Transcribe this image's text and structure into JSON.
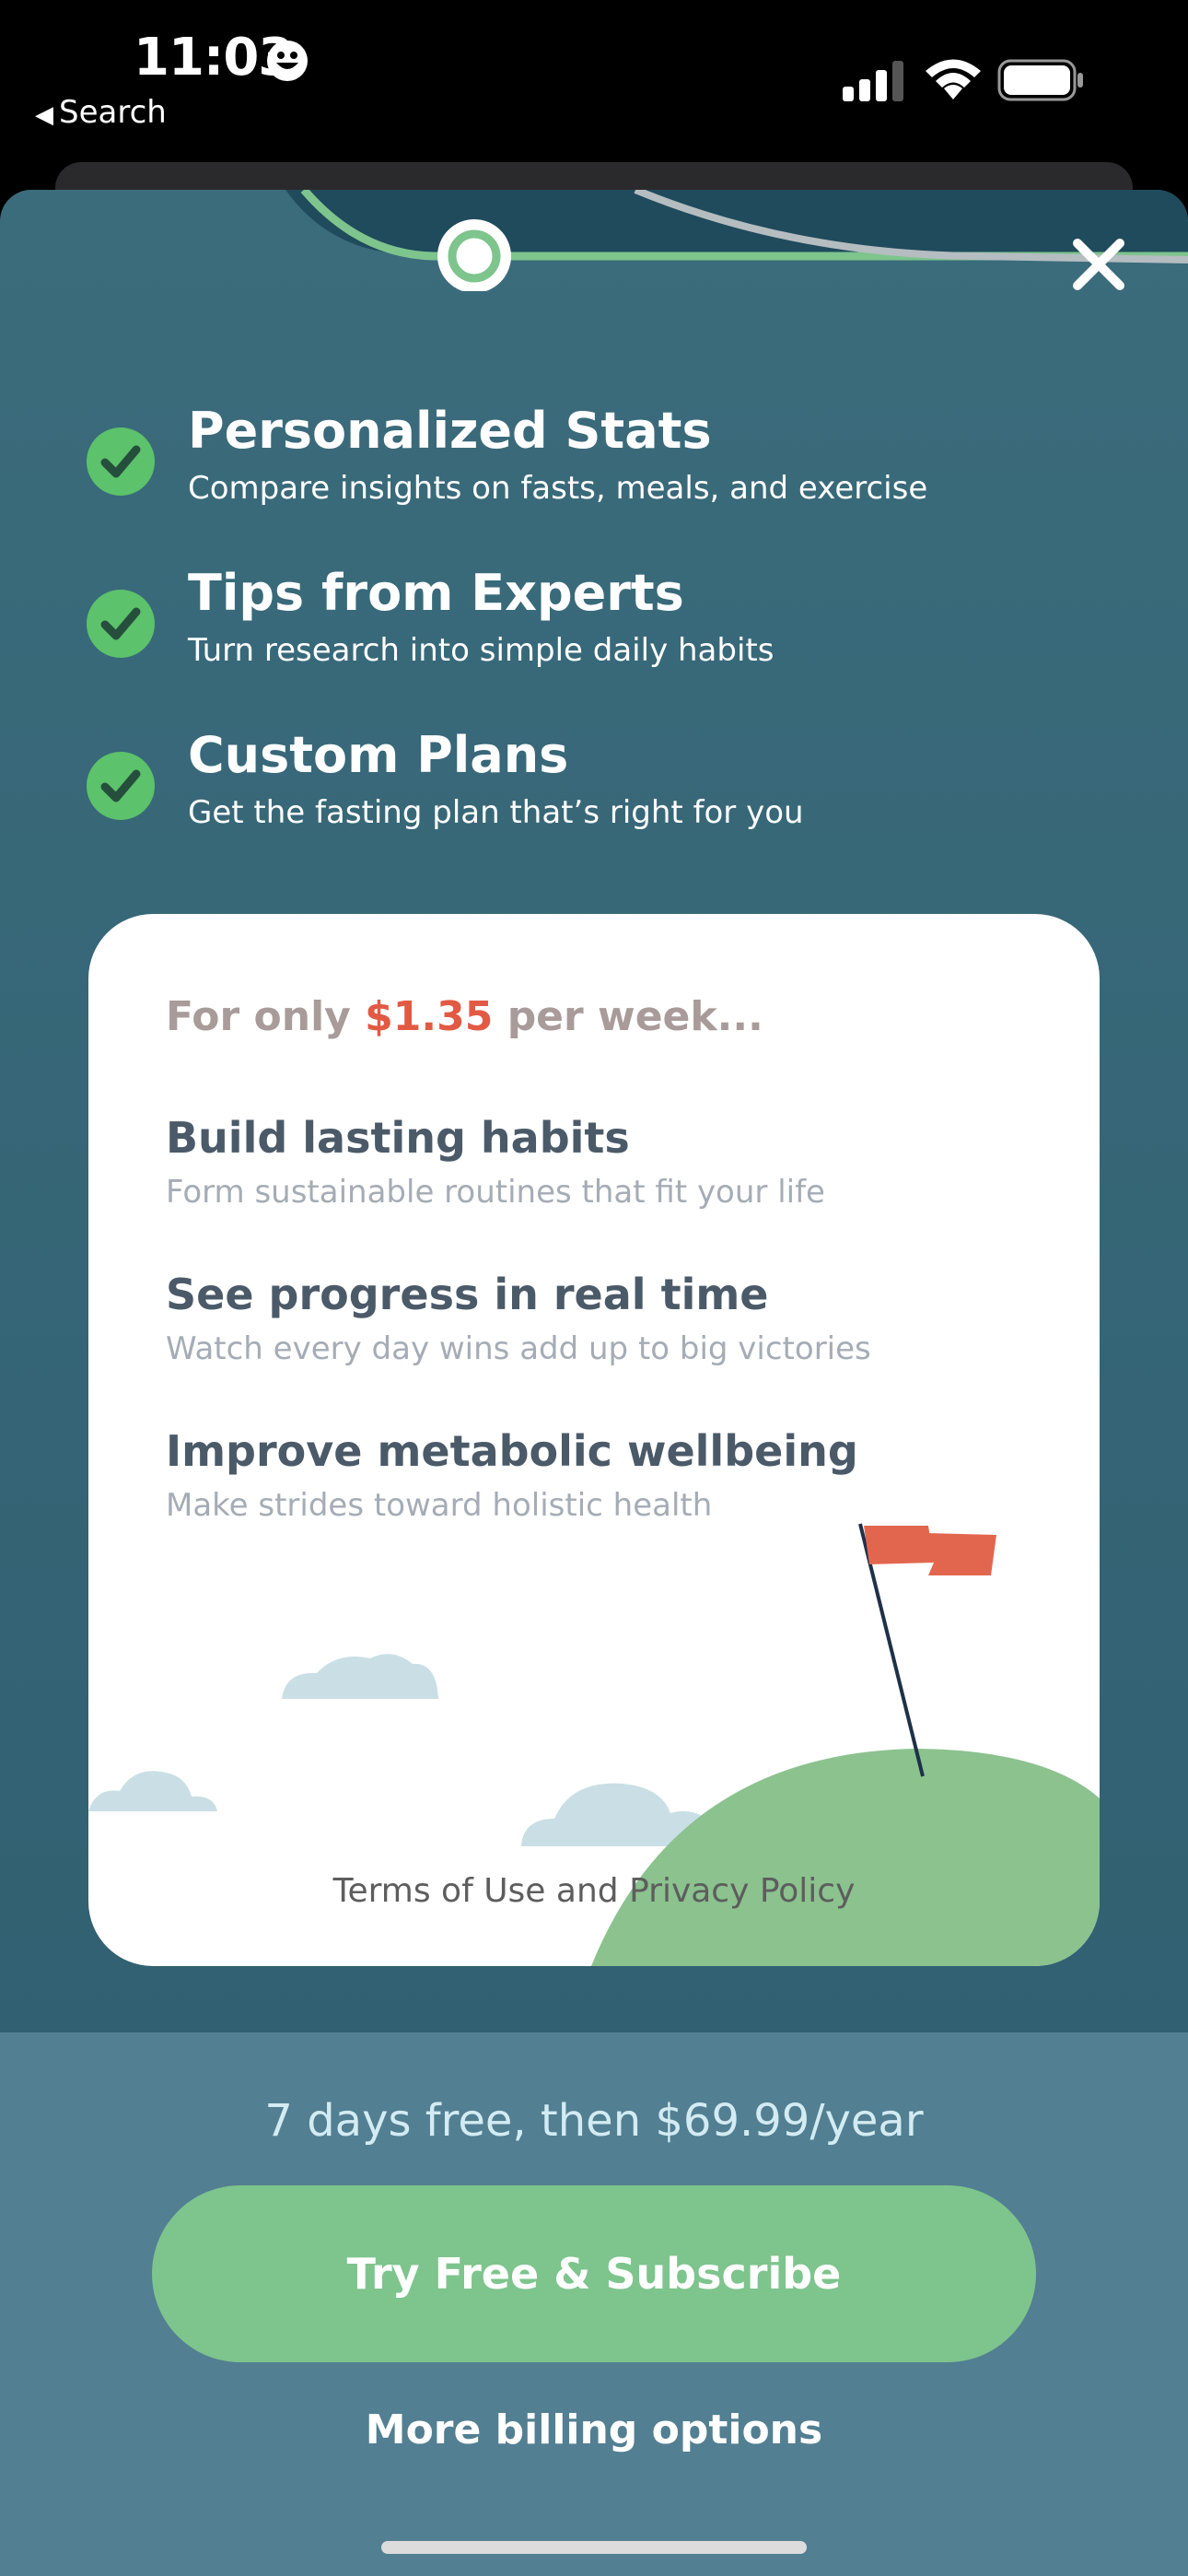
{
  "status_bar": {
    "time": "11:03",
    "back_label": "Search"
  },
  "features": [
    {
      "title": "Personalized Stats",
      "subtitle": "Compare insights on fasts, meals, and exercise"
    },
    {
      "title": "Tips from Experts",
      "subtitle": "Turn research into simple daily habits"
    },
    {
      "title": "Custom Plans",
      "subtitle": "Get the fasting plan that’s right for you"
    }
  ],
  "card": {
    "price_prefix": "For only",
    "price": "$1.35",
    "price_suffix": "per week...",
    "benefits": [
      {
        "title": "Build lasting habits",
        "subtitle": "Form sustainable routines that fit your life"
      },
      {
        "title": "See progress in real time",
        "subtitle": "Watch every day wins add up to big victories"
      },
      {
        "title": "Improve metabolic wellbeing",
        "subtitle": "Make strides toward holistic health"
      }
    ],
    "terms": "Terms of Use and Privacy Policy"
  },
  "footer": {
    "offer": "7 days free, then $69.99/year",
    "cta_label": "Try Free & Subscribe",
    "more_label": "More billing options"
  },
  "colors": {
    "sheet_bg": "#3b6c7c",
    "check_green": "#5cc26b",
    "price_red": "#e25a44",
    "cta_green": "#7ec48d",
    "footer_bg": "#527f92"
  },
  "icons": [
    "smiley-icon",
    "back-arrow-icon",
    "signal-icon",
    "wifi-icon",
    "battery-icon",
    "progress-node-icon",
    "close-icon",
    "check-icon",
    "flag-icon"
  ]
}
